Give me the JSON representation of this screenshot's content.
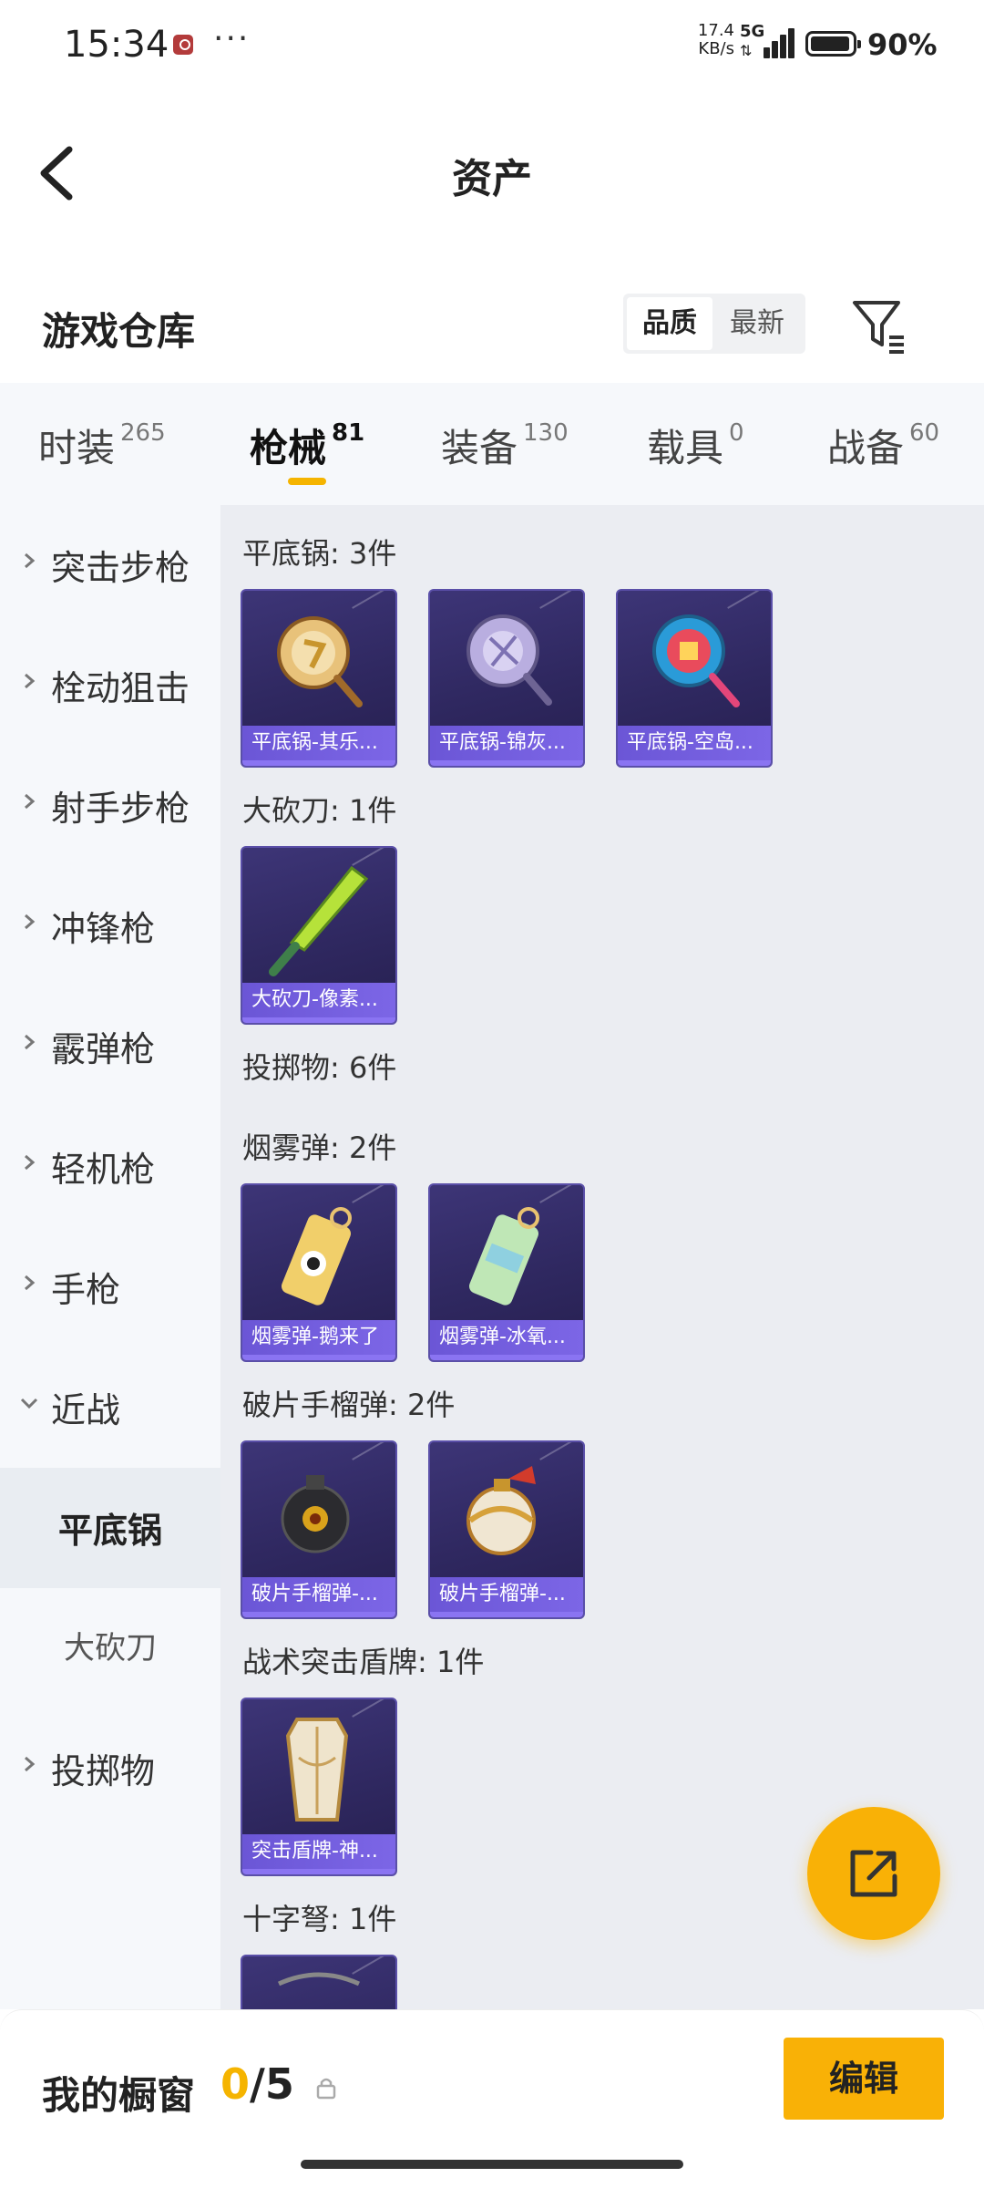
{
  "status_bar": {
    "time": "15:34",
    "dots": "···",
    "speed_value": "17.4",
    "speed_unit": "KB/s",
    "network": "5G",
    "battery_percent": "90%"
  },
  "header": {
    "title": "资产",
    "back_icon": "chevron-left-icon"
  },
  "warehouse": {
    "title": "游戏仓库",
    "sort_options": [
      "品质",
      "最新"
    ],
    "selected_sort": "品质",
    "filter_icon": "filter-icon"
  },
  "tabs": [
    {
      "label": "时装",
      "count": "265"
    },
    {
      "label": "枪械",
      "count": "81"
    },
    {
      "label": "装备",
      "count": "130"
    },
    {
      "label": "载具",
      "count": "0"
    },
    {
      "label": "战备",
      "count": "60"
    }
  ],
  "active_tab": "枪械",
  "side_nav": [
    {
      "label": "突击步枪",
      "expanded": false
    },
    {
      "label": "栓动狙击",
      "expanded": false
    },
    {
      "label": "射手步枪",
      "expanded": false
    },
    {
      "label": "冲锋枪",
      "expanded": false
    },
    {
      "label": "霰弹枪",
      "expanded": false
    },
    {
      "label": "轻机枪",
      "expanded": false
    },
    {
      "label": "手枪",
      "expanded": false
    },
    {
      "label": "近战",
      "expanded": true
    },
    {
      "label": "平底锅",
      "sub": true,
      "selected": true
    },
    {
      "label": "大砍刀",
      "sub": true,
      "selected": false
    },
    {
      "label": "投掷物",
      "expanded": false
    }
  ],
  "content": {
    "groups": [
      {
        "title": "平底锅: 3件",
        "items": [
          "平底锅-其乐...",
          "平底锅-锦灰...",
          "平底锅-空岛..."
        ]
      },
      {
        "title": "大砍刀: 1件",
        "items": [
          "大砍刀-像素..."
        ]
      },
      {
        "title": "投掷物: 6件",
        "items": []
      },
      {
        "title": "烟雾弹: 2件",
        "items": [
          "烟雾弹-鹅来了",
          "烟雾弹-冰氧..."
        ]
      },
      {
        "title": "破片手榴弹: 2件",
        "items": [
          "破片手榴弹-...",
          "破片手榴弹-..."
        ]
      },
      {
        "title": "战术突击盾牌: 1件",
        "items": [
          "突击盾牌-神..."
        ]
      },
      {
        "title": "十字弩: 1件",
        "items": [
          ""
        ]
      }
    ]
  },
  "fab": {
    "icon": "share-out-icon"
  },
  "bottom_bar": {
    "label": "我的橱窗",
    "current": "0",
    "separator": "/",
    "max": "5",
    "lock_icon": "lock-icon",
    "edit_label": "编辑"
  },
  "colors": {
    "accent": "#f9b106",
    "card_bg": "#2f2860",
    "card_label_bg": "#6b56d6",
    "content_bg": "#ebedf2",
    "nav_bg": "#f6f8fb"
  }
}
